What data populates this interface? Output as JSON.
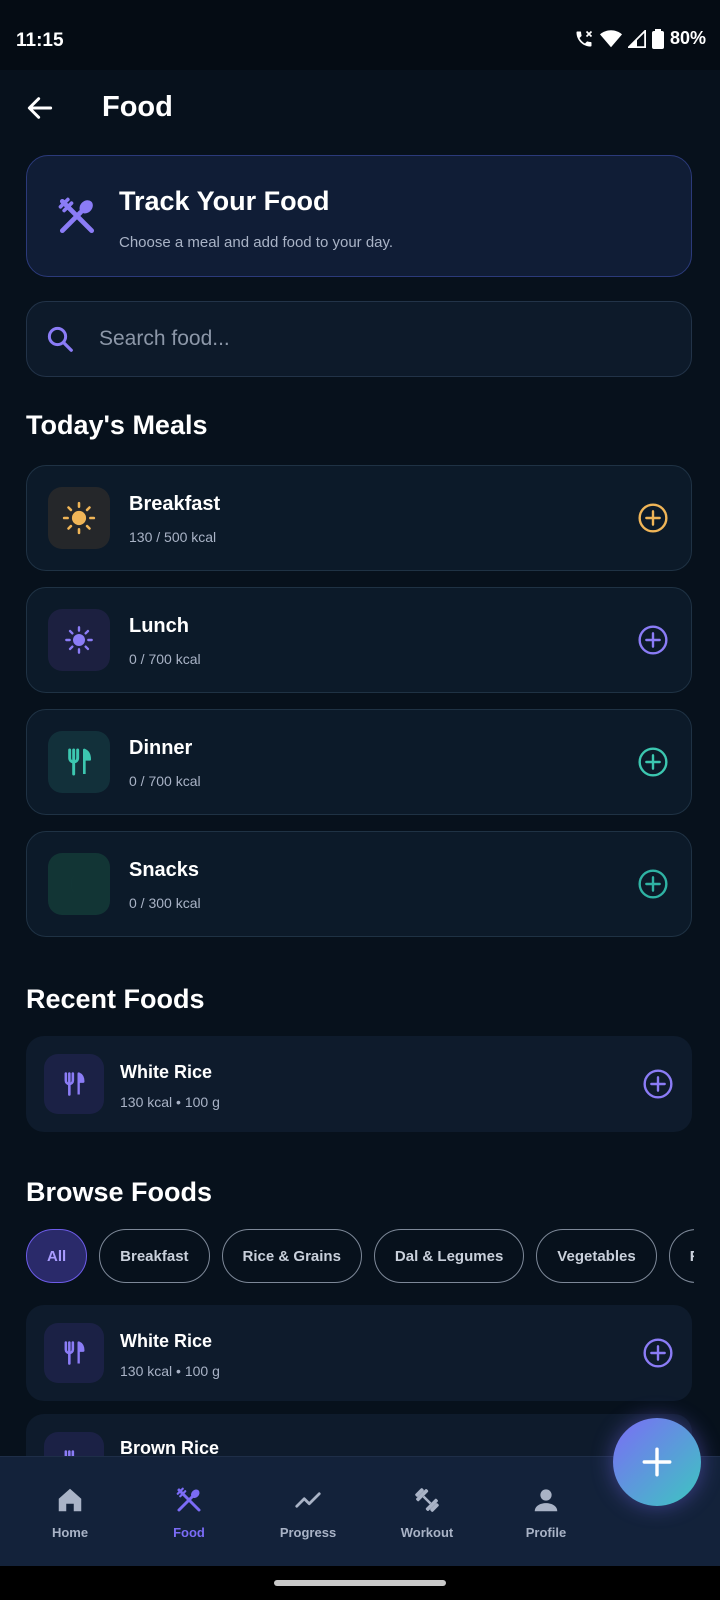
{
  "status_bar": {
    "time": "11:15",
    "battery": "80%"
  },
  "header": {
    "title": "Food",
    "back_icon": "arrow-left-icon"
  },
  "track_card": {
    "title": "Track Your Food",
    "subtitle": "Choose a meal and add food to your day.",
    "icon": "utensils-icon"
  },
  "search": {
    "placeholder": "Search food..."
  },
  "meals_section": {
    "title": "Today's Meals",
    "items": [
      {
        "name": "Breakfast",
        "kcal": "130 / 500 kcal",
        "icon": "sun-icon",
        "accent": "#f0b557"
      },
      {
        "name": "Lunch",
        "kcal": "0 / 700 kcal",
        "icon": "sun-small-icon",
        "accent": "#7b6cf6"
      },
      {
        "name": "Dinner",
        "kcal": "0 / 700 kcal",
        "icon": "fork-knife-icon",
        "accent": "#3cc7b0"
      },
      {
        "name": "Snacks",
        "kcal": "0 / 300 kcal",
        "icon": "moon-icon",
        "accent": "#2fb3a4"
      }
    ]
  },
  "recent_section": {
    "title": "Recent Foods",
    "items": [
      {
        "name": "White Rice",
        "meta": "130 kcal • 100 g"
      }
    ]
  },
  "browse_section": {
    "title": "Browse Foods",
    "chips": [
      "All",
      "Breakfast",
      "Rice & Grains",
      "Dal & Legumes",
      "Vegetables",
      "Fruits"
    ],
    "active_chip": "All",
    "items": [
      {
        "name": "White Rice",
        "meta": "130 kcal • 100 g"
      },
      {
        "name": "Brown Rice",
        "meta": ""
      }
    ]
  },
  "bottom_nav": {
    "items": [
      {
        "label": "Home",
        "icon": "home-icon"
      },
      {
        "label": "Food",
        "icon": "utensils-icon"
      },
      {
        "label": "Progress",
        "icon": "trend-icon"
      },
      {
        "label": "Workout",
        "icon": "dumbbell-icon"
      },
      {
        "label": "Profile",
        "icon": "person-icon"
      }
    ],
    "active": "Food"
  },
  "fab": {
    "icon": "plus-icon"
  },
  "colors": {
    "background": "#07111c",
    "accent_purple": "#7b6cf6",
    "accent_teal": "#3cc7b0",
    "accent_orange": "#f0b557"
  }
}
